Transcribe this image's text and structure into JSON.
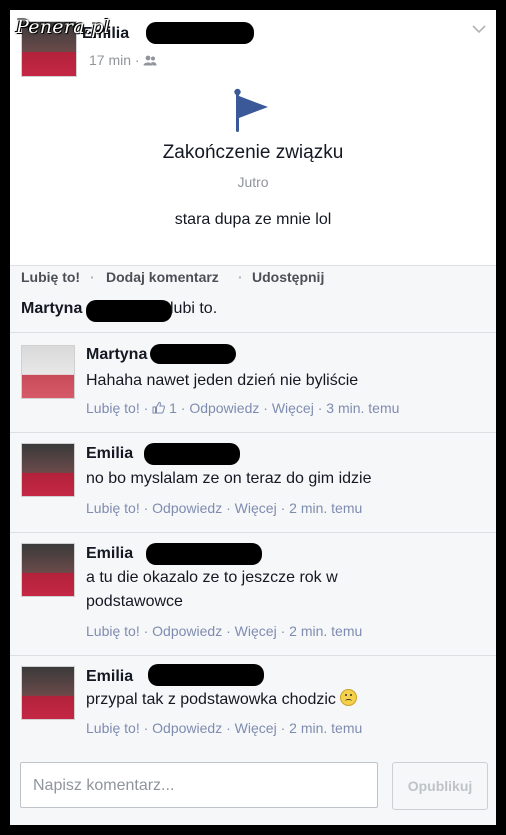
{
  "watermark": "Penera.pl",
  "post": {
    "author_visible": "Emilia",
    "time": "17 min",
    "audience_icon": "friends-icon",
    "event_title": "Zakończenie związku",
    "event_date": "Jutro",
    "status_text": "stara dupa ze mnie lol"
  },
  "actions": {
    "like": "Lubię to!",
    "comment": "Dodaj komentarz",
    "share": "Udostępnij"
  },
  "likes": {
    "name": "Martyna",
    "suffix": "lubi to."
  },
  "comments": [
    {
      "name": "Martyna",
      "text": "Hahaha nawet jeden dzień nie byliście",
      "meta_like": "Lubię to!",
      "like_count": "1",
      "meta_reply": "Odpowiedz",
      "meta_more": "Więcej",
      "time": "3 min. temu"
    },
    {
      "name": "Emilia",
      "text": "no bo myslalam ze on teraz do gim idzie",
      "meta_like": "Lubię to!",
      "meta_reply": "Odpowiedz",
      "meta_more": "Więcej",
      "time": "2 min. temu"
    },
    {
      "name": "Emilia",
      "text": "a tu die okazalo ze to jeszcze rok w podstawowce",
      "meta_like": "Lubię to!",
      "meta_reply": "Odpowiedz",
      "meta_more": "Więcej",
      "time": "2 min. temu"
    },
    {
      "name": "Emilia",
      "text": "przypal tak z podstawowka chodzic",
      "meta_like": "Lubię to!",
      "meta_reply": "Odpowiedz",
      "meta_more": "Więcej",
      "time": "2 min. temu"
    }
  ],
  "composer": {
    "placeholder": "Napisz komentarz...",
    "publish": "Opublikuj"
  },
  "colors": {
    "link": "#7f8cb0",
    "flag": "#3b5998"
  }
}
